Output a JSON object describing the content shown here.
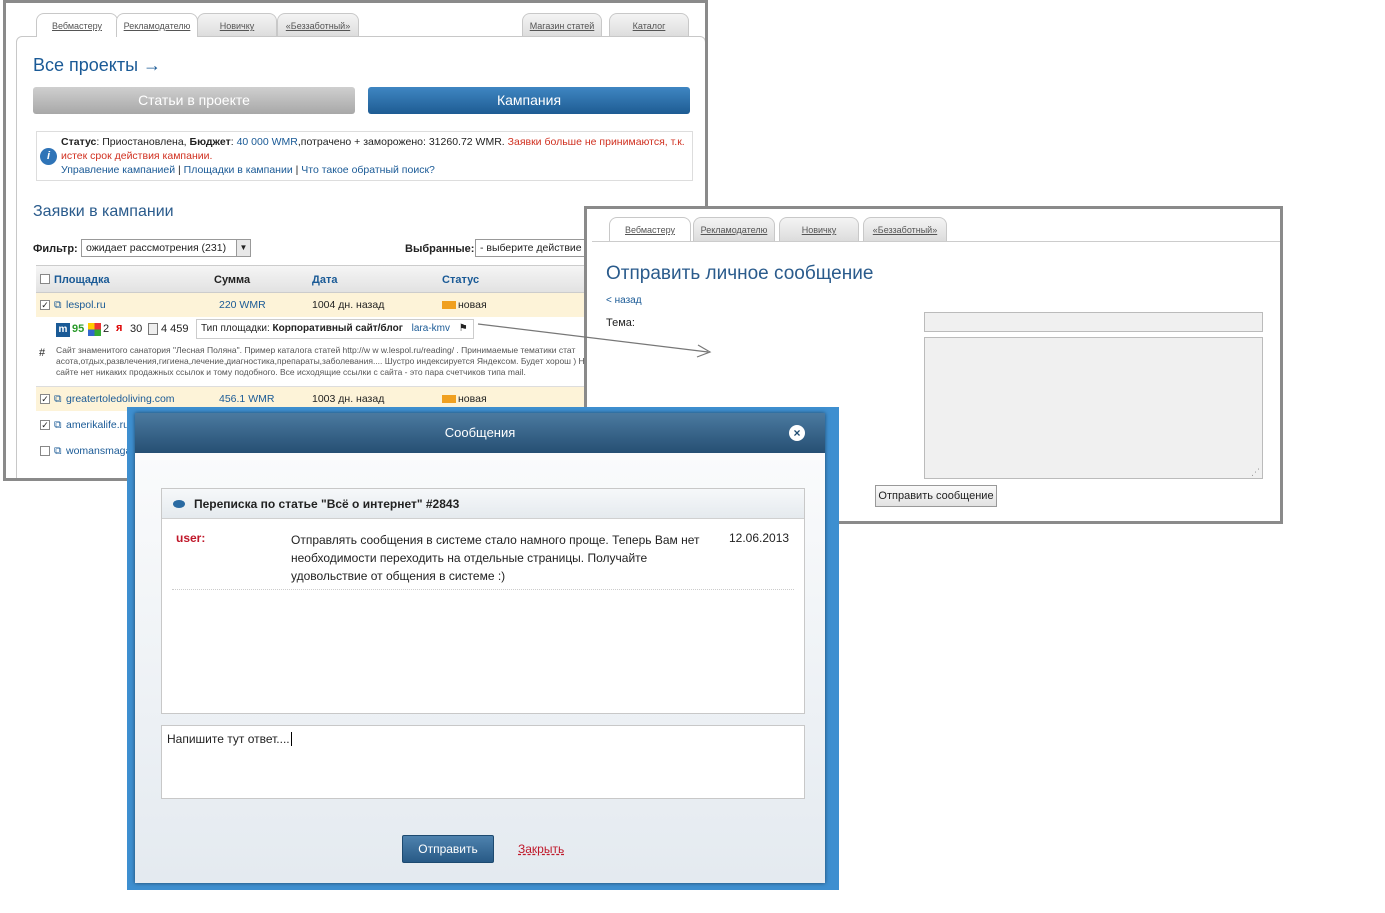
{
  "back_window": {
    "tabs": [
      "Вебмастеру",
      "Рекламодателю",
      "Новичку",
      "«Беззаботный»",
      "Магазин статей",
      "Каталог"
    ],
    "all_projects": "Все проекты →",
    "btn_articles": "Статьи в проекте",
    "btn_campaign": "Кампания",
    "status_label": "Статус",
    "status_value": ": Приостановлена, ",
    "budget_label": "Бюджет",
    "budget_value": "40 000 WMR",
    "spent": ",потрачено + заморожено: 31260.72 WMR.",
    "warning": "Заявки больше не принимаются, т.к. истек срок действия кампании.",
    "links": [
      "Управление кампанией",
      "Площадки в кампании",
      "Что такое обратный поиск?"
    ],
    "link_sep": "|",
    "requests_title": "Заявки в кампании",
    "filter_label": "Фильтр:",
    "filter_value": "ожидает рассмотрения (231)",
    "selected_label": "Выбранные:",
    "selected_value": "- выберите действие -",
    "columns": [
      "Площадка",
      "Сумма",
      "Дата",
      "Статус"
    ],
    "rows": [
      {
        "site": "lespol.ru",
        "sum": "220 WMR",
        "date": "1004 дн. назад",
        "status": "новая"
      },
      {
        "site": "greatertoledoliving.com",
        "sum": "456.1 WMR",
        "date": "1003 дн. назад",
        "status": "новая"
      },
      {
        "site": "amerikalife.ru",
        "sum": "",
        "date": "",
        "status": ""
      },
      {
        "site": "womansmaga",
        "sum": "",
        "date": "",
        "status": ""
      }
    ],
    "metrics": {
      "m": "95",
      "g": "2",
      "y": "30",
      "pages": "4 459"
    },
    "site_type_label": "Тип площадки:",
    "site_type_value": "Корпоративный сайт/блог",
    "owner": "lara-kmv",
    "hash": "#",
    "description": "Сайт знаменитого санатория \"Лесная Поляна\". Пример каталога статей http://w w w.lespol.ru/reading/ . Принимаемые тематики стат асота,отдых,развлечения,гигиена,лечение,диагностика,препараты,заболевания.... Шустро индексируется Яндексом. Будет хорош ) На сайте нет никаких продажных ссылок и тому подобного. Все исходящие ссылки с сайта - это пара счетчиков типа mail."
  },
  "pm_window": {
    "tabs": [
      "Вебмастеру",
      "Рекламодателю",
      "Новичку",
      "«Беззаботный»"
    ],
    "title": "Отправить личное сообщение",
    "back": "< назад",
    "subject_label": "Тема:",
    "send_button": "Отправить сообщение"
  },
  "modal": {
    "title": "Сообщения",
    "thread_title": "Переписка по статье \"Всё о интернет\" #2843",
    "message": {
      "author": "user:",
      "text": "Отправлять сообщения в системе стало намного проще. Теперь Вам нет необходимости переходить на отдельные страницы. Получайте удовольствие от общения в системе :)",
      "date": "12.06.2013"
    },
    "reply_text": "Напишите тут ответ....",
    "send_button": "Отправить",
    "close_link": "Закрыть"
  },
  "colors": {
    "link": "#1a5a96",
    "blue_button": "#2a6aa2",
    "warning": "#d03020",
    "modal_border": "#3e8fd0",
    "author": "#c0182a"
  }
}
